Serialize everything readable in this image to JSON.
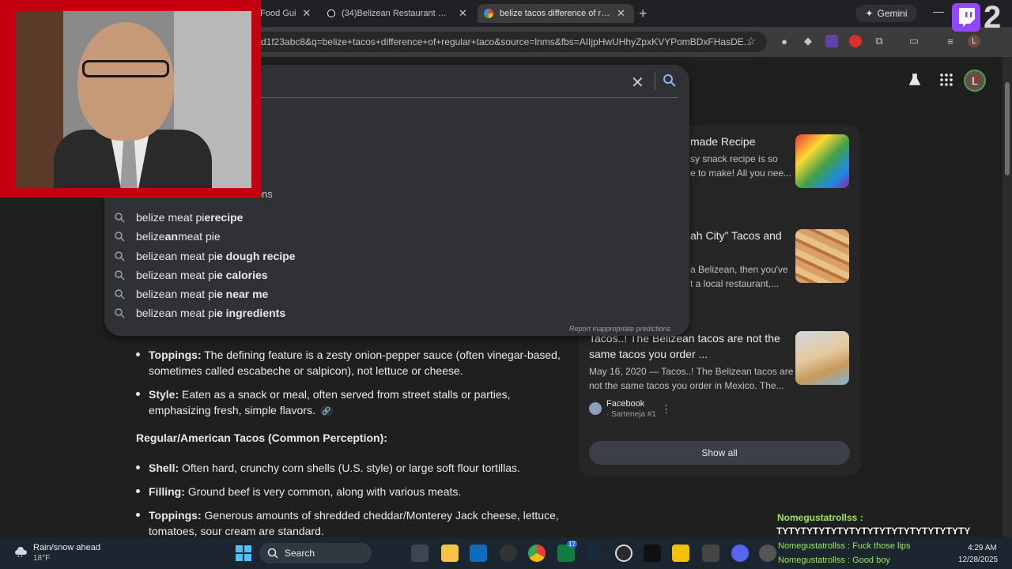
{
  "tabs": [
    {
      "label": "n Food Gui",
      "favicon_color": "#4285f4"
    },
    {
      "label": "(34)Belizean Restaurant Nyc | Ti",
      "favicon_color": "#ffffff"
    },
    {
      "label": "belize tacos difference of regul",
      "favicon_color": "#4285f4"
    }
  ],
  "gemini_label": "Gemini",
  "address_bar": {
    "url": "d1f23abc8&q=belize+tacos+difference+of+regular+taco&source=lnms&fbs=AIIjpHwUHhyZpxKVYPomBDxFHasDE..."
  },
  "search": {
    "suggestions_heading": "...ctions",
    "suggestions": [
      {
        "plain": "belize meat pi",
        "plain2": "e ",
        "bold": "recipe"
      },
      {
        "plain": "belize",
        "plain2": "an",
        "bold": " meat pie"
      },
      {
        "plain": "belize",
        "plain2": "an meat pi",
        "bold": "e dough recipe"
      },
      {
        "plain": "belize",
        "plain2": "an meat pi",
        "bold": "e calories"
      },
      {
        "plain": "belize",
        "plain2": "an meat pi",
        "bold": "e near me"
      },
      {
        "plain": "belize",
        "plain2": "an meat pi",
        "bold": "e ingredients"
      }
    ],
    "report_label": "Report inappropriate predictions"
  },
  "avatar_letter": "L",
  "side_cards": [
    {
      "title": "made Recipe",
      "snippet1": "sy snack recipe is so",
      "snippet2": "e to make! All you nee..."
    },
    {
      "title": "ah City” Tacos and",
      "snippet1": "a Belizean, then you've",
      "snippet2": "t a local restaurant,..."
    },
    {
      "title1": "Tacos..! The Belizean tacos are not the",
      "title2": "same tacos you order ...",
      "snippet1": "May 16, 2020 — Tacos..! The Belizean tacos are",
      "snippet2": "not the same tacos you order in Mexico. The...",
      "source": "Facebook",
      "source_sub": "· Sarteneja #1"
    }
  ],
  "show_all_label": "Show all",
  "article": {
    "belize_items": [
      {
        "label": "Toppings:",
        "line1": " The defining feature is a zesty onion-pepper sauce (often vinegar-based,",
        "line2": "sometimes called escabeche or salpicon), not lettuce or cheese."
      },
      {
        "label": "Style:",
        "line1": " Eaten as a snack or meal, often served from street stalls or parties,",
        "line2": "emphasizing fresh, simple flavors."
      }
    ],
    "american_heading": "Regular/American Tacos (Common Perception):",
    "american_items": [
      {
        "label": "Shell:",
        "line1": " Often hard, crunchy corn shells (U.S. style) or large soft flour tortillas."
      },
      {
        "label": "Filling:",
        "line1": " Ground beef is very common, along with various meats."
      },
      {
        "label": "Toppings:",
        "line1": " Generous amounts of shredded cheddar/Monterey Jack cheese, lettuce,",
        "line2": "tomatoes, sour cream are standard."
      }
    ]
  },
  "stream_overlay": {
    "twitch_count": "2",
    "chat_user": "Nomegustatrollss :",
    "chat_message": "TYTYTYTYTYTYTYTYTYTYTYTYTYTYTYTY",
    "chat_line2": "Nomegustatrollss : Fuck those lips",
    "chat_line3": "Nomegustatrollss : Good boy"
  },
  "taskbar": {
    "weather_line1": "Rain/snow ahead",
    "weather_line2": "18°F",
    "search_label": "Search",
    "time": "4:29 AM",
    "date": "12/28/2025",
    "badge_count": "17"
  }
}
